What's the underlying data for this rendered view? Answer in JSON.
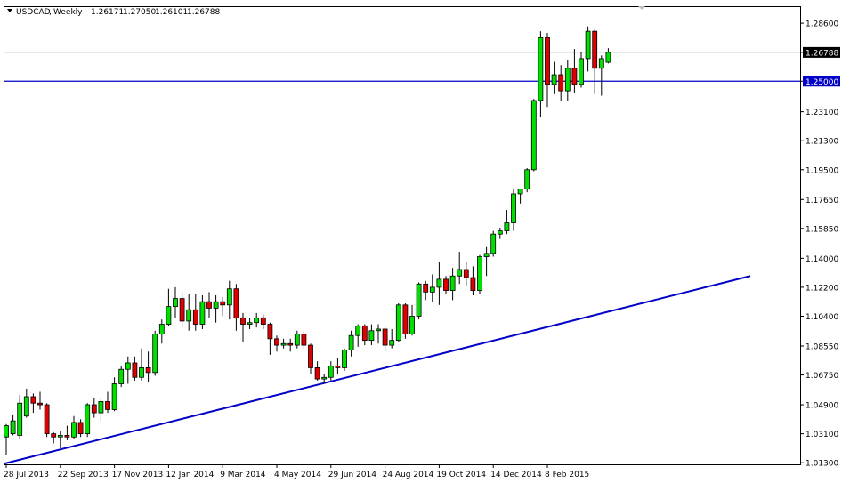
{
  "chart_data": {
    "type": "candlestick",
    "symbol": "USDCAD",
    "timeframe": "Weekly",
    "ohlc_readout": {
      "open": "1.26171",
      "high": "1.27050",
      "low": "1.26101",
      "close": "1.26788"
    },
    "ylim": [
      1.012,
      1.296
    ],
    "y_ticks": [
      "1.28600",
      "1.26788",
      "1.25000",
      "1.23100",
      "1.21300",
      "1.19500",
      "1.17650",
      "1.15850",
      "1.14000",
      "1.12200",
      "1.10400",
      "1.08550",
      "1.06750",
      "1.04900",
      "1.03100",
      "1.01300"
    ],
    "x_ticks": [
      "28 Jul 2013",
      "22 Sep 2013",
      "17 Nov 2013",
      "12 Jan 2014",
      "9 Mar 2014",
      "4 May 2014",
      "29 Jun 2014",
      "24 Aug 2014",
      "19 Oct 2014",
      "14 Dec 2014",
      "8 Feb 2015"
    ],
    "x_tick_index": [
      0,
      8,
      16,
      24,
      32,
      40,
      48,
      56,
      64,
      72,
      80
    ],
    "current_price": {
      "label": "1.26788",
      "value": 1.26788,
      "color": "#ffffff",
      "bg": "#000000"
    },
    "horizontal_line": {
      "label": "1.25000",
      "value": 1.25,
      "color": "#0000c8"
    },
    "trendline": {
      "start": {
        "index": 0,
        "price": 1.0125
      },
      "end": {
        "index": 110,
        "price": 1.129
      },
      "color": "#0000c8"
    },
    "colors": {
      "bull": "#00e000",
      "bear": "#e00000",
      "wick": "#000000",
      "grid_price": "#c0c0c0"
    },
    "candles": [
      {
        "o": 1.029,
        "h": 1.037,
        "l": 1.018,
        "c": 1.036
      },
      {
        "o": 1.031,
        "h": 1.043,
        "l": 1.03,
        "c": 1.039
      },
      {
        "o": 1.03,
        "h": 1.055,
        "l": 1.028,
        "c": 1.05
      },
      {
        "o": 1.042,
        "h": 1.059,
        "l": 1.041,
        "c": 1.054
      },
      {
        "o": 1.054,
        "h": 1.056,
        "l": 1.044,
        "c": 1.05
      },
      {
        "o": 1.05,
        "h": 1.057,
        "l": 1.046,
        "c": 1.049
      },
      {
        "o": 1.049,
        "h": 1.05,
        "l": 1.029,
        "c": 1.031
      },
      {
        "o": 1.031,
        "h": 1.032,
        "l": 1.025,
        "c": 1.029
      },
      {
        "o": 1.029,
        "h": 1.033,
        "l": 1.022,
        "c": 1.03
      },
      {
        "o": 1.03,
        "h": 1.036,
        "l": 1.027,
        "c": 1.029
      },
      {
        "o": 1.029,
        "h": 1.042,
        "l": 1.028,
        "c": 1.038
      },
      {
        "o": 1.038,
        "h": 1.04,
        "l": 1.029,
        "c": 1.031
      },
      {
        "o": 1.031,
        "h": 1.05,
        "l": 1.029,
        "c": 1.049
      },
      {
        "o": 1.049,
        "h": 1.053,
        "l": 1.041,
        "c": 1.044
      },
      {
        "o": 1.044,
        "h": 1.053,
        "l": 1.039,
        "c": 1.051
      },
      {
        "o": 1.051,
        "h": 1.057,
        "l": 1.044,
        "c": 1.046
      },
      {
        "o": 1.046,
        "h": 1.066,
        "l": 1.045,
        "c": 1.062
      },
      {
        "o": 1.062,
        "h": 1.073,
        "l": 1.06,
        "c": 1.071
      },
      {
        "o": 1.071,
        "h": 1.079,
        "l": 1.062,
        "c": 1.075
      },
      {
        "o": 1.075,
        "h": 1.079,
        "l": 1.064,
        "c": 1.066
      },
      {
        "o": 1.066,
        "h": 1.084,
        "l": 1.064,
        "c": 1.072
      },
      {
        "o": 1.072,
        "h": 1.082,
        "l": 1.063,
        "c": 1.069
      },
      {
        "o": 1.069,
        "h": 1.095,
        "l": 1.067,
        "c": 1.093
      },
      {
        "o": 1.093,
        "h": 1.102,
        "l": 1.087,
        "c": 1.099
      },
      {
        "o": 1.099,
        "h": 1.121,
        "l": 1.098,
        "c": 1.11
      },
      {
        "o": 1.11,
        "h": 1.122,
        "l": 1.103,
        "c": 1.115
      },
      {
        "o": 1.115,
        "h": 1.119,
        "l": 1.097,
        "c": 1.101
      },
      {
        "o": 1.101,
        "h": 1.118,
        "l": 1.095,
        "c": 1.108
      },
      {
        "o": 1.108,
        "h": 1.118,
        "l": 1.095,
        "c": 1.099
      },
      {
        "o": 1.099,
        "h": 1.117,
        "l": 1.096,
        "c": 1.113
      },
      {
        "o": 1.113,
        "h": 1.119,
        "l": 1.103,
        "c": 1.109
      },
      {
        "o": 1.109,
        "h": 1.117,
        "l": 1.1,
        "c": 1.113
      },
      {
        "o": 1.113,
        "h": 1.116,
        "l": 1.104,
        "c": 1.111
      },
      {
        "o": 1.111,
        "h": 1.126,
        "l": 1.102,
        "c": 1.121
      },
      {
        "o": 1.121,
        "h": 1.124,
        "l": 1.095,
        "c": 1.103
      },
      {
        "o": 1.103,
        "h": 1.106,
        "l": 1.088,
        "c": 1.099
      },
      {
        "o": 1.099,
        "h": 1.103,
        "l": 1.096,
        "c": 1.1
      },
      {
        "o": 1.1,
        "h": 1.106,
        "l": 1.097,
        "c": 1.103
      },
      {
        "o": 1.103,
        "h": 1.105,
        "l": 1.096,
        "c": 1.099
      },
      {
        "o": 1.099,
        "h": 1.1,
        "l": 1.08,
        "c": 1.09
      },
      {
        "o": 1.09,
        "h": 1.092,
        "l": 1.082,
        "c": 1.086
      },
      {
        "o": 1.086,
        "h": 1.09,
        "l": 1.084,
        "c": 1.087
      },
      {
        "o": 1.087,
        "h": 1.09,
        "l": 1.082,
        "c": 1.086
      },
      {
        "o": 1.086,
        "h": 1.095,
        "l": 1.084,
        "c": 1.093
      },
      {
        "o": 1.093,
        "h": 1.095,
        "l": 1.084,
        "c": 1.086
      },
      {
        "o": 1.086,
        "h": 1.087,
        "l": 1.068,
        "c": 1.072
      },
      {
        "o": 1.072,
        "h": 1.076,
        "l": 1.064,
        "c": 1.065
      },
      {
        "o": 1.065,
        "h": 1.068,
        "l": 1.062,
        "c": 1.066
      },
      {
        "o": 1.066,
        "h": 1.076,
        "l": 1.064,
        "c": 1.073
      },
      {
        "o": 1.073,
        "h": 1.078,
        "l": 1.068,
        "c": 1.072
      },
      {
        "o": 1.072,
        "h": 1.084,
        "l": 1.07,
        "c": 1.083
      },
      {
        "o": 1.083,
        "h": 1.095,
        "l": 1.079,
        "c": 1.092
      },
      {
        "o": 1.092,
        "h": 1.099,
        "l": 1.085,
        "c": 1.098
      },
      {
        "o": 1.098,
        "h": 1.099,
        "l": 1.086,
        "c": 1.089
      },
      {
        "o": 1.089,
        "h": 1.099,
        "l": 1.086,
        "c": 1.095
      },
      {
        "o": 1.095,
        "h": 1.099,
        "l": 1.087,
        "c": 1.096
      },
      {
        "o": 1.096,
        "h": 1.098,
        "l": 1.082,
        "c": 1.086
      },
      {
        "o": 1.086,
        "h": 1.096,
        "l": 1.084,
        "c": 1.089
      },
      {
        "o": 1.089,
        "h": 1.112,
        "l": 1.088,
        "c": 1.111
      },
      {
        "o": 1.111,
        "h": 1.112,
        "l": 1.09,
        "c": 1.093
      },
      {
        "o": 1.093,
        "h": 1.111,
        "l": 1.092,
        "c": 1.104
      },
      {
        "o": 1.104,
        "h": 1.125,
        "l": 1.102,
        "c": 1.124
      },
      {
        "o": 1.124,
        "h": 1.126,
        "l": 1.114,
        "c": 1.119
      },
      {
        "o": 1.119,
        "h": 1.13,
        "l": 1.113,
        "c": 1.122
      },
      {
        "o": 1.122,
        "h": 1.138,
        "l": 1.111,
        "c": 1.127
      },
      {
        "o": 1.127,
        "h": 1.129,
        "l": 1.118,
        "c": 1.12
      },
      {
        "o": 1.12,
        "h": 1.134,
        "l": 1.114,
        "c": 1.129
      },
      {
        "o": 1.129,
        "h": 1.144,
        "l": 1.124,
        "c": 1.133
      },
      {
        "o": 1.133,
        "h": 1.138,
        "l": 1.123,
        "c": 1.128
      },
      {
        "o": 1.128,
        "h": 1.135,
        "l": 1.117,
        "c": 1.12
      },
      {
        "o": 1.12,
        "h": 1.142,
        "l": 1.118,
        "c": 1.141
      },
      {
        "o": 1.141,
        "h": 1.147,
        "l": 1.129,
        "c": 1.143
      },
      {
        "o": 1.143,
        "h": 1.157,
        "l": 1.141,
        "c": 1.155
      },
      {
        "o": 1.155,
        "h": 1.159,
        "l": 1.152,
        "c": 1.157
      },
      {
        "o": 1.157,
        "h": 1.17,
        "l": 1.155,
        "c": 1.162
      },
      {
        "o": 1.162,
        "h": 1.183,
        "l": 1.157,
        "c": 1.18
      },
      {
        "o": 1.18,
        "h": 1.183,
        "l": 1.174,
        "c": 1.183
      },
      {
        "o": 1.183,
        "h": 1.196,
        "l": 1.181,
        "c": 1.195
      },
      {
        "o": 1.195,
        "h": 1.239,
        "l": 1.194,
        "c": 1.238
      },
      {
        "o": 1.238,
        "h": 1.281,
        "l": 1.228,
        "c": 1.277
      },
      {
        "o": 1.277,
        "h": 1.28,
        "l": 1.234,
        "c": 1.248
      },
      {
        "o": 1.248,
        "h": 1.262,
        "l": 1.242,
        "c": 1.254
      },
      {
        "o": 1.254,
        "h": 1.26,
        "l": 1.238,
        "c": 1.244
      },
      {
        "o": 1.244,
        "h": 1.263,
        "l": 1.238,
        "c": 1.258
      },
      {
        "o": 1.258,
        "h": 1.27,
        "l": 1.243,
        "c": 1.248
      },
      {
        "o": 1.248,
        "h": 1.268,
        "l": 1.246,
        "c": 1.264
      },
      {
        "o": 1.264,
        "h": 1.284,
        "l": 1.256,
        "c": 1.281
      },
      {
        "o": 1.281,
        "h": 1.282,
        "l": 1.242,
        "c": 1.258
      },
      {
        "o": 1.258,
        "h": 1.266,
        "l": 1.241,
        "c": 1.264
      },
      {
        "o": 1.26171,
        "h": 1.2705,
        "l": 1.26101,
        "c": 1.26788
      }
    ]
  }
}
